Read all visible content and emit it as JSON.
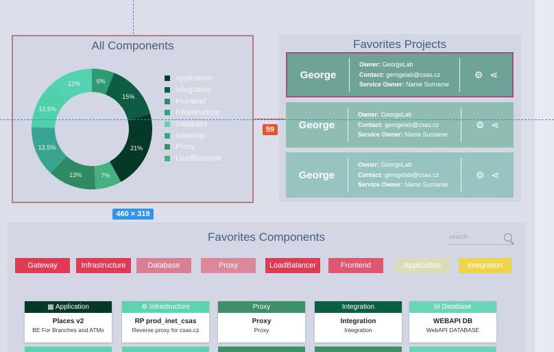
{
  "all_components": {
    "title": "All Components",
    "legend": [
      {
        "label": "Application",
        "color": "#073b2c"
      },
      {
        "label": "Integration",
        "color": "#0d5c44"
      },
      {
        "label": "Frontend",
        "color": "#2e8a67"
      },
      {
        "label": "Infrastructure",
        "color": "#35a07f"
      },
      {
        "label": "Database",
        "color": "#5fd3b0"
      },
      {
        "label": "Gateway",
        "color": "#3aa493"
      },
      {
        "label": "Proxy",
        "color": "#3e8f69"
      },
      {
        "label": "LoadBalancer",
        "color": "#46b081"
      }
    ]
  },
  "chart_data": {
    "type": "pie",
    "slices": [
      {
        "label": "6%",
        "value": 6,
        "color": "#2e9b72"
      },
      {
        "label": "15%",
        "value": 15,
        "color": "#0d5c44"
      },
      {
        "label": "21%",
        "value": 21,
        "color": "#063828"
      },
      {
        "label": "7%",
        "value": 7,
        "color": "#46b081"
      },
      {
        "label": "13%",
        "value": 13,
        "color": "#2f8a64"
      },
      {
        "label": "13,5%",
        "value": 13.5,
        "color": "#3aa493"
      },
      {
        "label": "12,5%",
        "value": 12.5,
        "color": "#4fd0ab"
      },
      {
        "label": "12%",
        "value": 12,
        "color": "#55d2b0"
      }
    ]
  },
  "favorites_projects": {
    "title": "Favorites Projects",
    "cards": [
      {
        "name": "George",
        "owner_label": "Owner:",
        "owner": "GeorgeLab",
        "contact_label": "Contact:",
        "contact": "gerogelab@csas.cz",
        "service_label": "Service Owner:",
        "service": "Name Surname",
        "color": "#6fa397"
      },
      {
        "name": "George",
        "owner_label": "Owner:",
        "owner": "GeorgeLab",
        "contact_label": "Contact:",
        "contact": "gerogelab@csas.cz",
        "service_label": "Service Owner:",
        "service": "Name Surname",
        "color": "#8fbdb2"
      },
      {
        "name": "George",
        "owner_label": "Owner:",
        "owner": "GeorgeLab",
        "contact_label": "Contact:",
        "contact": "gerogelab@csas.cz",
        "service_label": "Service Owner:",
        "service": "Name Surname",
        "color": "#97c3c1"
      }
    ]
  },
  "overlay": {
    "badge": "59",
    "dimensions": "460 × 319"
  },
  "favorites_components": {
    "title": "Favorites Components",
    "search_placeholder": "search",
    "chips": [
      {
        "label": "Gateway",
        "color": "#e03b55"
      },
      {
        "label": "Infrastructure",
        "color": "#e03b55"
      },
      {
        "label": "Database",
        "color": "#d97e93"
      },
      {
        "label": "Proxy",
        "color": "#dc879a"
      },
      {
        "label": "LoadBalancer",
        "color": "#e03b55"
      },
      {
        "label": "Frontend",
        "color": "#e05570"
      },
      {
        "label": "Application",
        "color": "#dcdcb8"
      },
      {
        "label": "Integration",
        "color": "#efd34b"
      }
    ],
    "cards": [
      {
        "head": "Application",
        "head_icon": "grid-icon",
        "head_color": "#063828",
        "title": "Places v2",
        "sub": "BE For Branches and ATMs"
      },
      {
        "head": "Infrastructure",
        "head_icon": "gear-icon",
        "head_color": "#5fd3b0",
        "title": "RP prod_inet_csas",
        "sub": "Reverse proxy for csas.cz"
      },
      {
        "head": "Proxy",
        "head_icon": "",
        "head_color": "#3e8f69",
        "title": "Proxy",
        "sub": "Proxy"
      },
      {
        "head": "Integration",
        "head_icon": "",
        "head_color": "#0d5c44",
        "title": "Integration",
        "sub": "Integration"
      },
      {
        "head": "Database",
        "head_icon": "database-icon",
        "head_color": "#6dd3b6",
        "title": "WEBAPI DB",
        "sub": "WebAPI DATABASE"
      }
    ],
    "next_row_colors": [
      "#5fd3b0",
      "#5fd3b0",
      "#3e8f69",
      "#3e8f69",
      "#6dd3b6"
    ]
  }
}
